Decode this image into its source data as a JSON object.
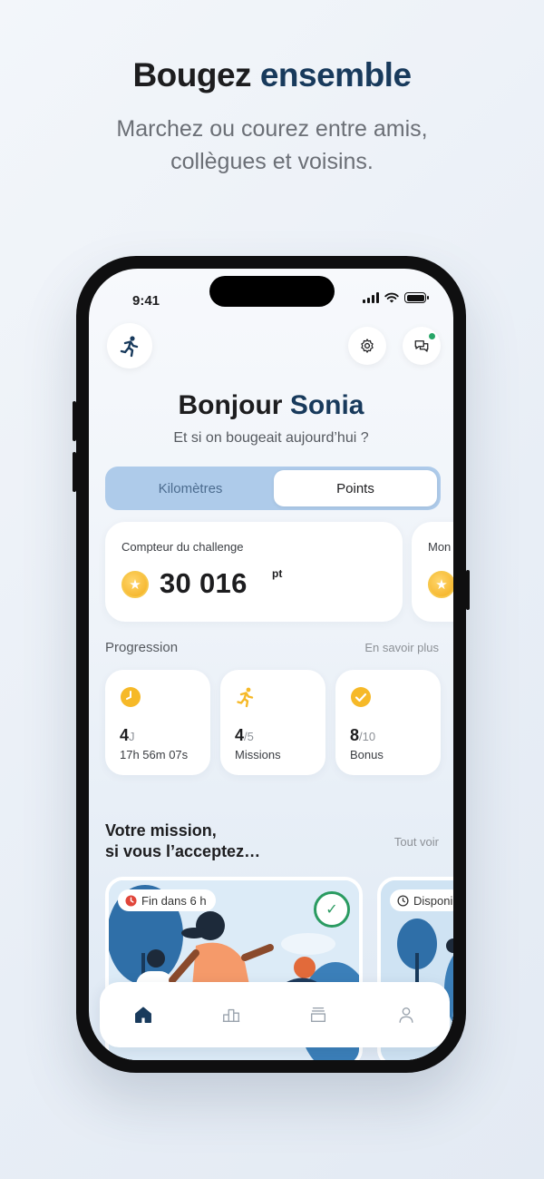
{
  "hero": {
    "title_part1": "Bougez",
    "title_part2": "ensemble",
    "subtitle": "Marchez ou courez entre amis, collègues et voisins."
  },
  "status_bar": {
    "time": "9:41"
  },
  "header": {
    "logo_icon": "runner-logo-icon",
    "settings_icon": "gear-icon",
    "chat_icon": "chat-icon"
  },
  "greeting": {
    "hello": "Bonjour",
    "name": "Sonia",
    "subtitle": "Et si on bougeait aujourd’hui ?"
  },
  "toggle": {
    "options": [
      "Kilomètres",
      "Points"
    ],
    "selected": "Points"
  },
  "counters": [
    {
      "label": "Compteur du challenge",
      "value": "30 016",
      "unit": "pt"
    },
    {
      "label": "Mon"
    }
  ],
  "progression": {
    "title": "Progression",
    "link": "En savoir plus",
    "cards": [
      {
        "icon": "clock-icon",
        "value": "4",
        "suffix": "J",
        "caption": "17h 56m 07s"
      },
      {
        "icon": "runner-icon",
        "value": "4",
        "suffix": "/5",
        "caption": "Missions"
      },
      {
        "icon": "check-circle-icon",
        "value": "8",
        "suffix": "/10",
        "caption": "Bonus"
      }
    ]
  },
  "missions": {
    "title_line1": "Votre mission,",
    "title_line2": "si vous l’acceptez…",
    "link": "Tout voir",
    "cards": [
      {
        "badge": "Fin dans 6 h",
        "completed": true
      },
      {
        "badge": "Disponi"
      }
    ]
  },
  "tabbar": {
    "items": [
      "home-icon",
      "leaderboard-icon",
      "challenges-icon",
      "profile-icon"
    ],
    "active": "home-icon"
  },
  "colors": {
    "brand_navy": "#183a5c",
    "toggle_bg": "#aecbea",
    "success": "#2a9b61",
    "coin": "#f3ae1d",
    "alert": "#e0453a"
  }
}
